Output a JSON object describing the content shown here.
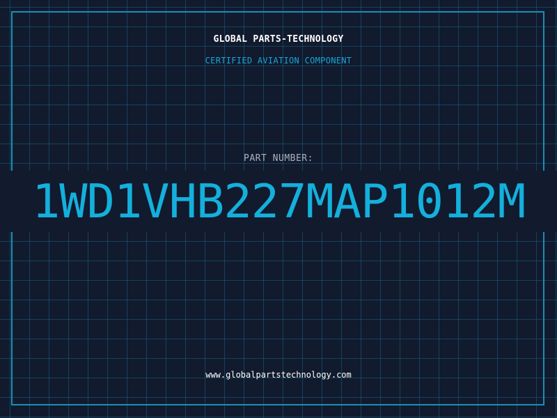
{
  "header": {
    "company": "GLOBAL PARTS-TECHNOLOGY",
    "tagline": "CERTIFIED AVIATION COMPONENT"
  },
  "part": {
    "label": "PART NUMBER:",
    "number": "1WD1VHB227MAP1012M"
  },
  "footer": {
    "website": "www.globalpartstechnology.com"
  },
  "colors": {
    "background": "#121a2e",
    "grid": "#16647f",
    "frame": "#1a8fb8",
    "accent": "#14b0dc",
    "label": "#a9b2c2",
    "text": "#ffffff"
  }
}
